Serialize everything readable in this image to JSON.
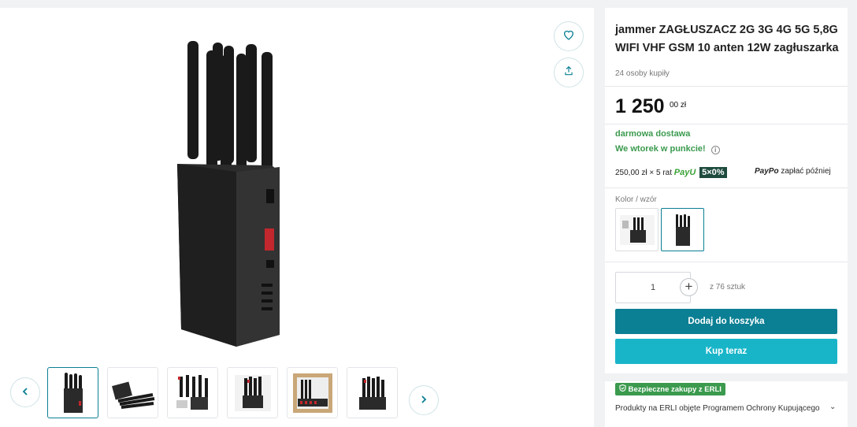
{
  "product": {
    "title": "jammer ZAGŁUSZACZ 2G 3G 4G 5G 5,8G WIFI VHF GSM 10 anten 12W zagłuszarka",
    "bought": "24 osoby kupiły",
    "price_main": "1 250",
    "price_decimal": "00 zł",
    "free_delivery": "darmowa dostawa",
    "delivery_when": "We wtorek w punkcie!",
    "installment_text": "250,00 zł × 5 rat",
    "payu_label": "PayU",
    "payu_badge": "5×0%",
    "paypo_label": "PayPo",
    "paypo_text": "zapłać później",
    "color_label": "Kolor / wzór",
    "quantity_value": "1",
    "quantity_of": "z 76 sztuk",
    "add_to_cart": "Dodaj do koszyka",
    "buy_now": "Kup teraz"
  },
  "gallery": {
    "thumbnails": [
      "thumbnail-1",
      "thumbnail-2",
      "thumbnail-3",
      "thumbnail-4",
      "thumbnail-5",
      "thumbnail-6"
    ],
    "active_index": 0
  },
  "secure": {
    "badge": "Bezpieczne zakupy z ERLI",
    "text": "Produkty na ERLI objęte Programem Ochrony Kupującego"
  },
  "icons": {
    "favorite": "heart-icon",
    "share": "share-icon",
    "prev": "chevron-left-icon",
    "next": "chevron-right-icon",
    "shield": "shield-check-icon",
    "info": "info-icon",
    "expand": "chevron-down-icon"
  },
  "colors": {
    "accent": "#0b7f93",
    "buy_button": "#18b5c9",
    "success": "#3b9a4e"
  }
}
